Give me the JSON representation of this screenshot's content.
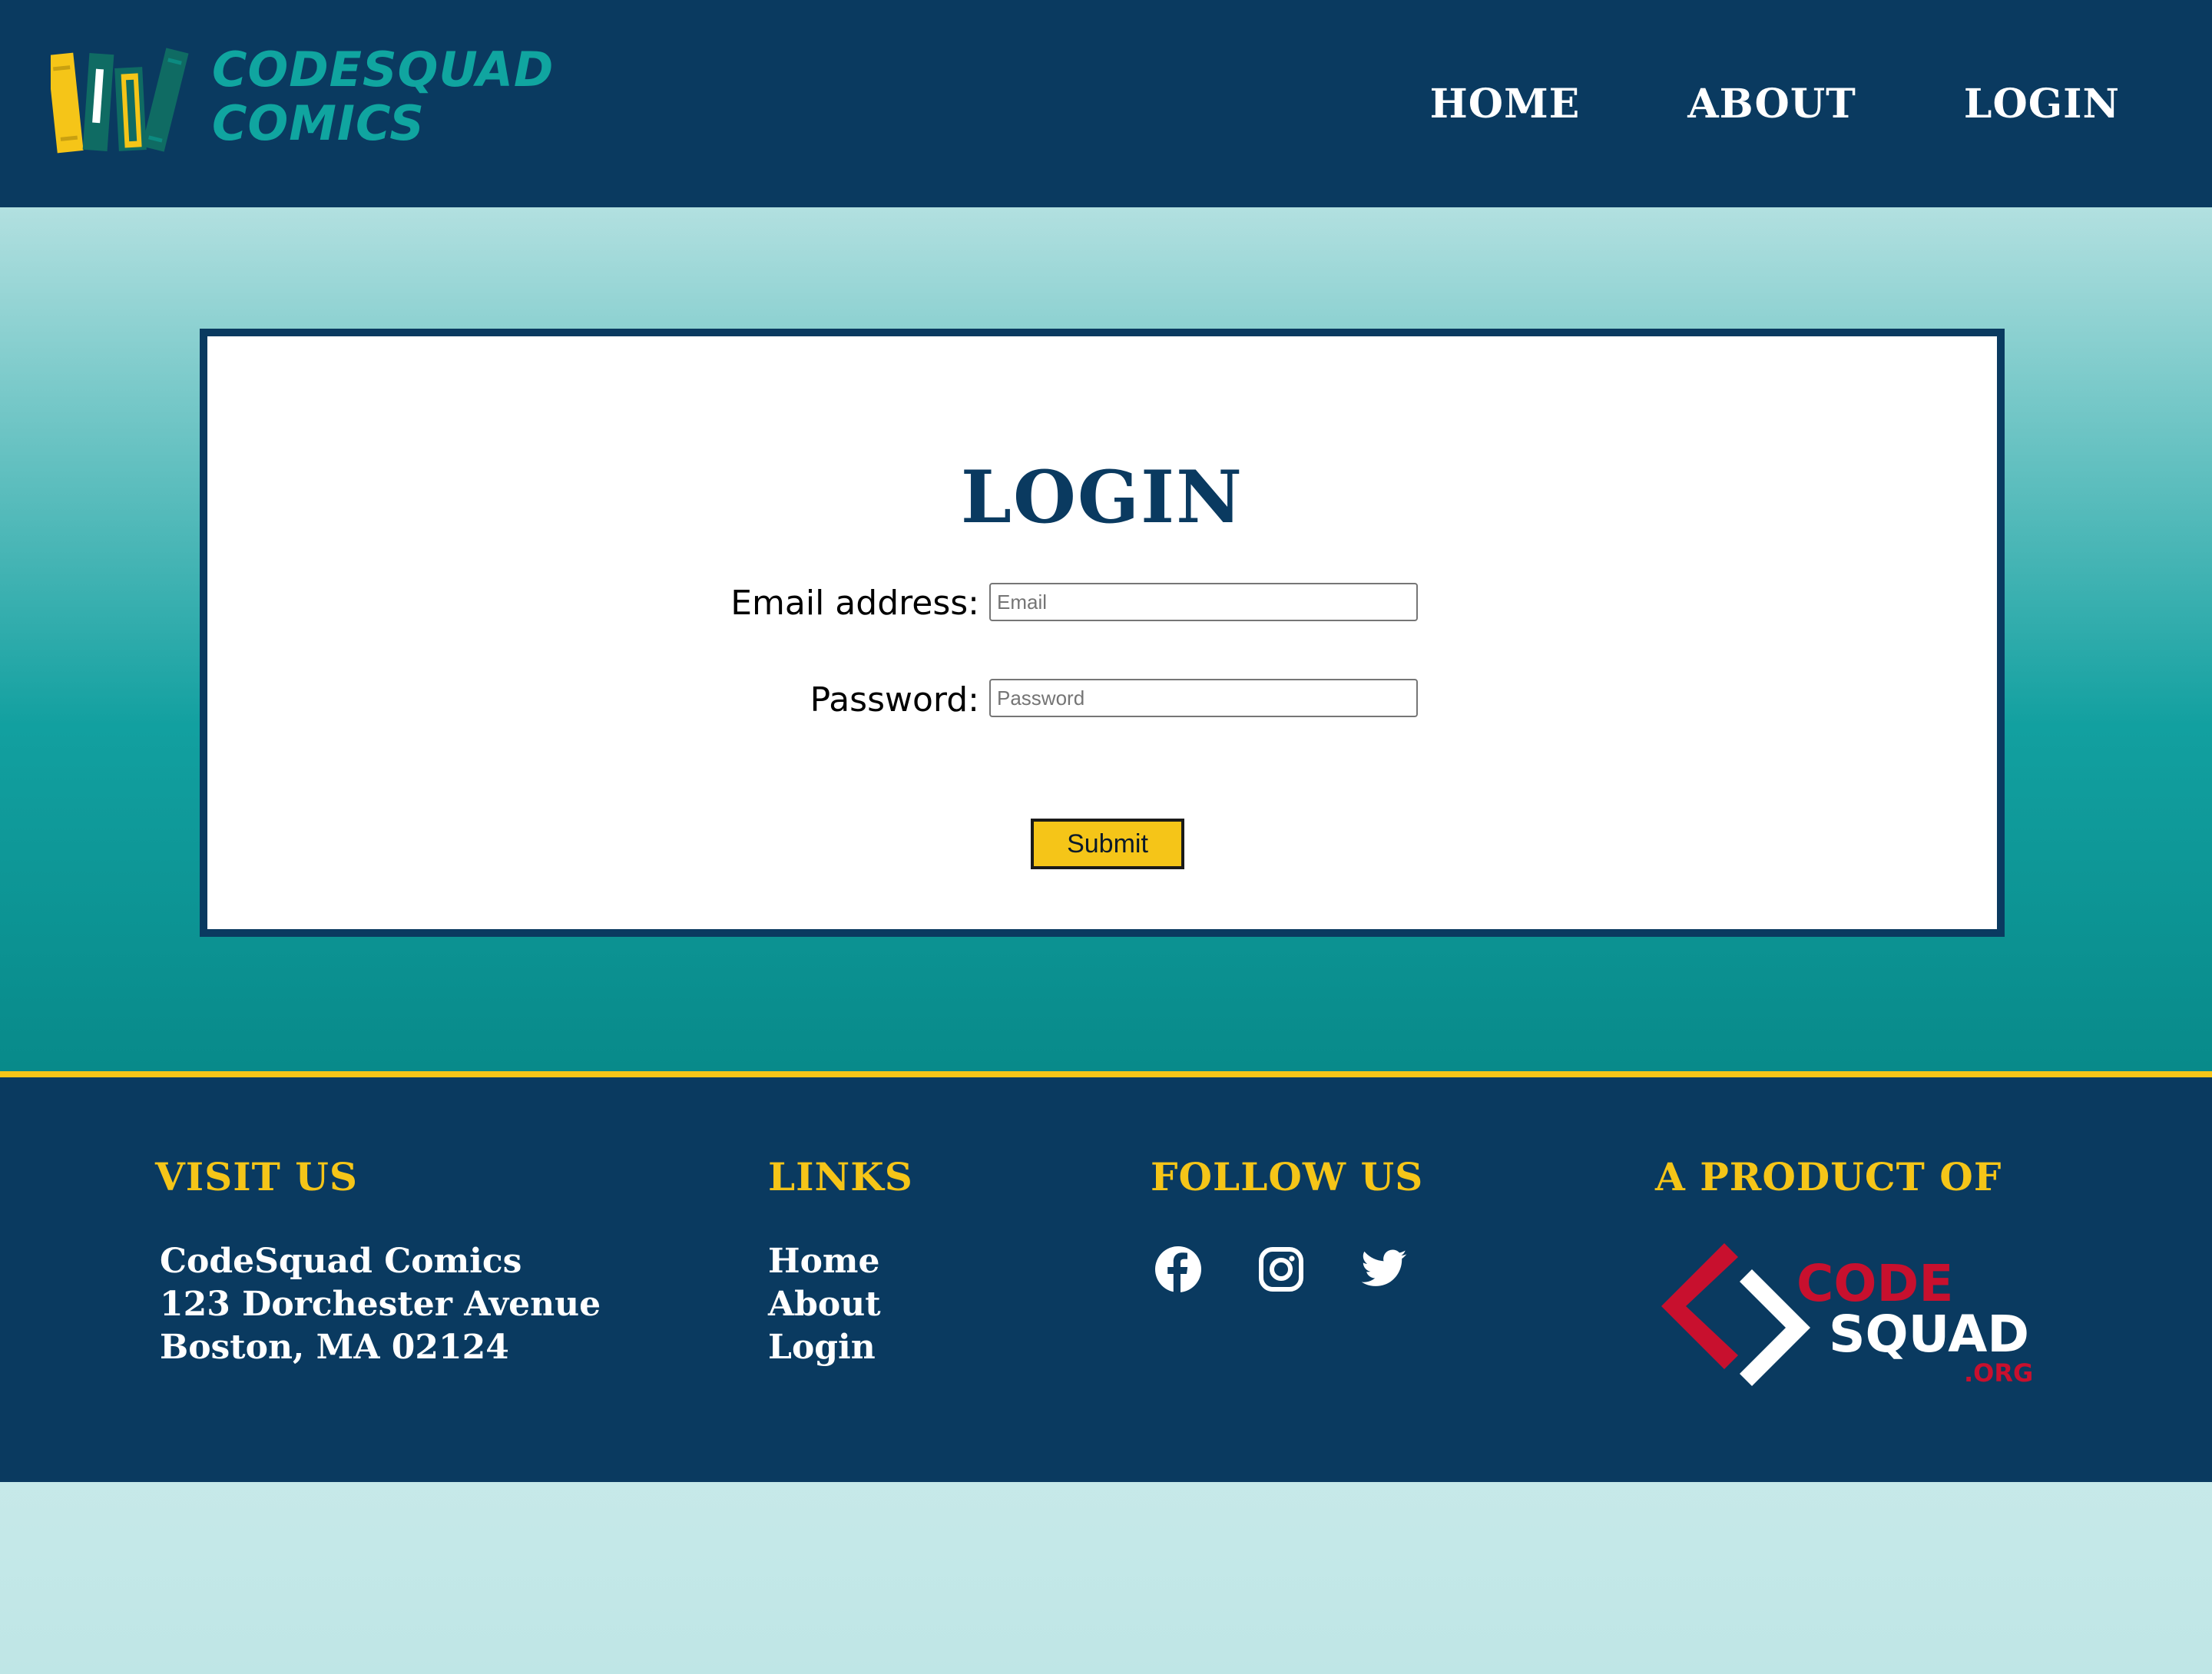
{
  "header": {
    "logo": {
      "line1": "CODESQUAD",
      "line2": "COMICS",
      "colors": {
        "text": "#10a5a0",
        "book_yellow": "#f5c518",
        "book_teal": "#0f6b63",
        "book_white": "#ffffff"
      }
    },
    "nav": [
      {
        "label": "HOME"
      },
      {
        "label": "ABOUT"
      },
      {
        "label": "LOGIN"
      }
    ]
  },
  "login": {
    "title": "LOGIN",
    "email_label": "Email address:",
    "email_placeholder": "Email",
    "email_value": "",
    "password_label": "Password:",
    "password_placeholder": "Password",
    "password_value": "",
    "submit_label": "Submit"
  },
  "footer": {
    "visit": {
      "heading": "VISIT US",
      "lines": [
        "CodeSquad Comics",
        "123 Dorchester Avenue",
        "Boston, MA 02124"
      ]
    },
    "links": {
      "heading": "LINKS",
      "items": [
        {
          "label": "Home"
        },
        {
          "label": "About"
        },
        {
          "label": "Login"
        }
      ]
    },
    "follow": {
      "heading": "FOLLOW US",
      "icons": [
        "facebook-icon",
        "instagram-icon",
        "twitter-icon"
      ]
    },
    "product": {
      "heading": "A PRODUCT OF",
      "logo": {
        "code": "CODE",
        "squad": "SQUAD",
        "org": ".ORG"
      }
    }
  },
  "colors": {
    "navy": "#0a3a60",
    "teal": "#12a0a0",
    "yellow": "#f5c518",
    "red": "#c8102e",
    "white": "#ffffff"
  }
}
